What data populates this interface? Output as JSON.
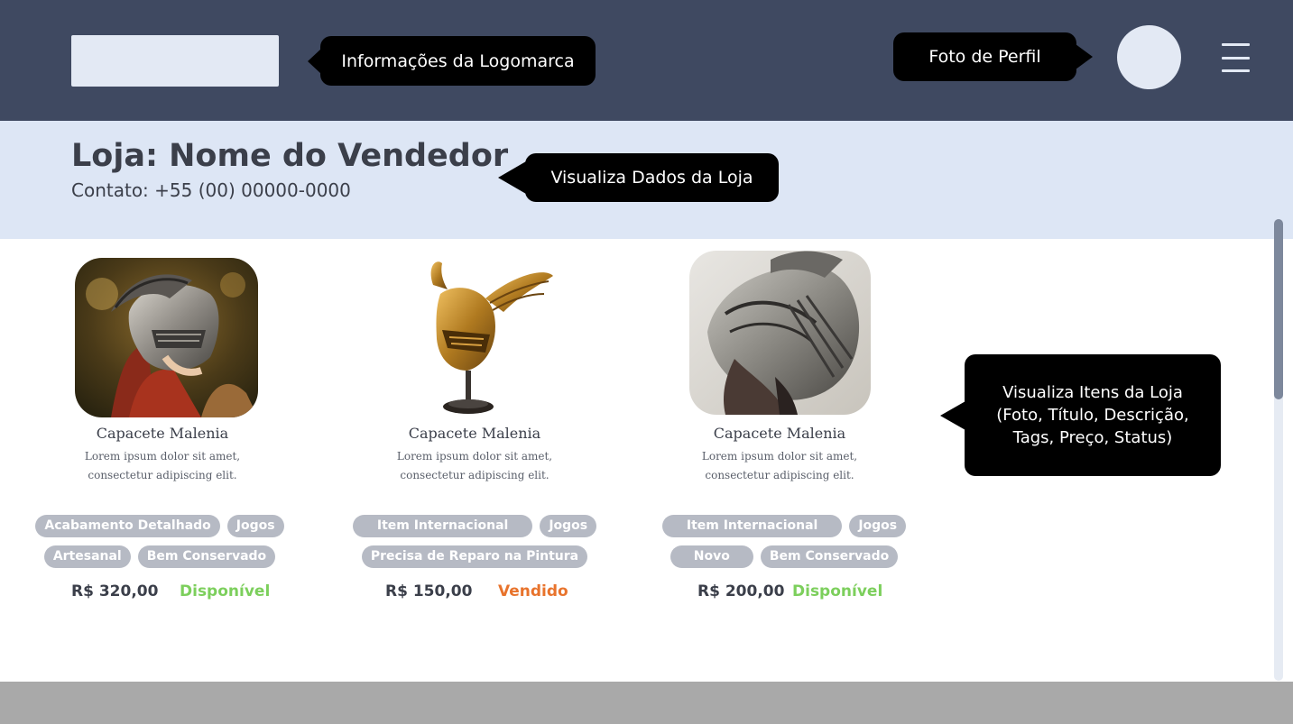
{
  "header": {
    "logo_callout": "Informações da Logomarca",
    "profile_callout": "Foto de Perfil"
  },
  "store": {
    "title": "Loja: Nome do Vendedor",
    "contact": "Contato: +55 (00) 00000-0000",
    "callout": "Visualiza Dados da Loja"
  },
  "items_callout": {
    "line1": "Visualiza Itens da Loja",
    "line2": "(Foto, Título, Descrição,",
    "line3": "Tags, Preço, Status)"
  },
  "items": [
    {
      "title": "Capacete Malenia",
      "desc_line1": "Lorem ipsum dolor sit amet,",
      "desc_line2": "consectetur adipiscing elit.",
      "tags": [
        "Acabamento Detalhado",
        "Jogos",
        "Artesanal",
        "Bem Conservado"
      ],
      "price": "R$ 320,00",
      "status": "Disponível",
      "status_color": "#7ccf5c",
      "image": "helmet-on-red-haired-woman"
    },
    {
      "title": "Capacete Malenia",
      "desc_line1": "Lorem ipsum dolor sit amet,",
      "desc_line2": "consectetur adipiscing elit.",
      "tags": [
        "Item Internacional",
        "Jogos",
        "Precisa de Reparo na Pintura"
      ],
      "price": "R$ 150,00",
      "status": "Vendido",
      "status_color": "#e8732c",
      "image": "golden-winged-helmet-on-stand"
    },
    {
      "title": "Capacete Malenia",
      "desc_line1": "Lorem ipsum dolor sit amet,",
      "desc_line2": "consectetur adipiscing elit.",
      "tags": [
        "Item Internacional",
        "Jogos",
        "Novo",
        "Bem Conservado"
      ],
      "price": "R$ 200,00",
      "status": "Disponível",
      "status_color": "#7ccf5c",
      "image": "silver-winged-helmet-closeup"
    }
  ],
  "colors": {
    "header_bg": "#3f4961",
    "store_band_bg": "#dde6f5",
    "tag_bg": "#b6bac4",
    "available": "#7ccf5c",
    "sold": "#e8732c"
  }
}
